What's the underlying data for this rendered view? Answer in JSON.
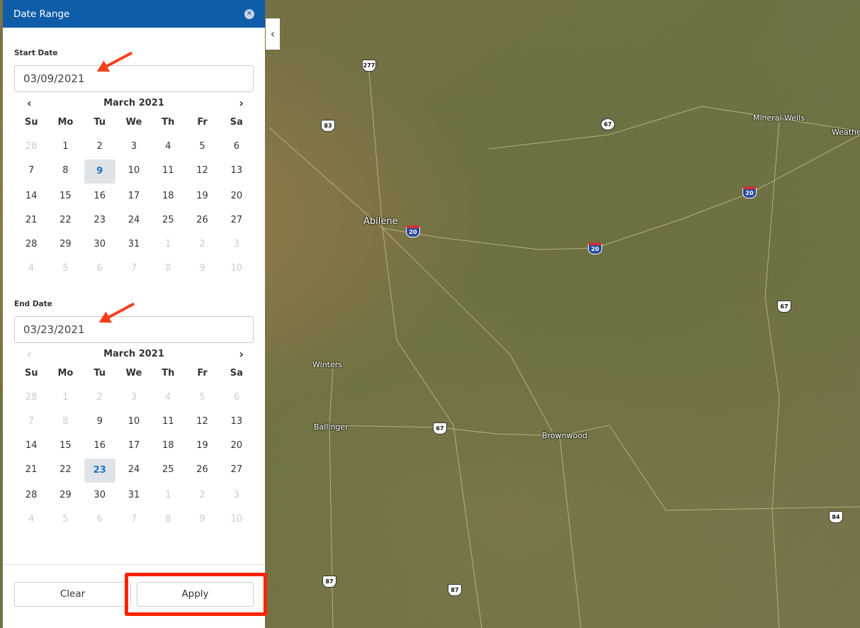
{
  "panel": {
    "title": "Date Range",
    "close_icon": "close-circle-icon"
  },
  "start": {
    "label": "Start Date",
    "value": "03/09/2021",
    "month": "March 2021",
    "selected": 9,
    "prev_disabled": false
  },
  "end": {
    "label": "End Date",
    "value": "03/23/2021",
    "month": "March 2021",
    "selected": 23,
    "prev_disabled": true
  },
  "weekdays": [
    "Su",
    "Mo",
    "Tu",
    "We",
    "Th",
    "Fr",
    "Sa"
  ],
  "calendar_days": [
    28,
    1,
    2,
    3,
    4,
    5,
    6,
    7,
    8,
    9,
    10,
    11,
    12,
    13,
    14,
    15,
    16,
    17,
    18,
    19,
    20,
    21,
    22,
    23,
    24,
    25,
    26,
    27,
    28,
    29,
    30,
    31,
    1,
    2,
    3,
    4,
    5,
    6,
    7,
    8,
    9,
    10
  ],
  "start_dim_indices": [
    0,
    32,
    33,
    34,
    35,
    36,
    37,
    38,
    39,
    40,
    41
  ],
  "end_dim_indices": [
    0,
    1,
    2,
    3,
    4,
    5,
    6,
    7,
    8,
    32,
    33,
    34,
    35,
    36,
    37,
    38,
    39,
    40,
    41
  ],
  "buttons": {
    "clear": "Clear",
    "apply": "Apply"
  },
  "map": {
    "places": [
      "Abilene",
      "Mineral Wells",
      "Weathe",
      "Winters",
      "Ballinger",
      "Brownwood"
    ],
    "shields": [
      "277",
      "83",
      "67",
      "20",
      "20",
      "20",
      "67",
      "67",
      "87",
      "87",
      "84"
    ]
  },
  "colors": {
    "header": "#0f5ca8",
    "selected_text": "#1f73c9",
    "annotation": "#ff2200"
  }
}
